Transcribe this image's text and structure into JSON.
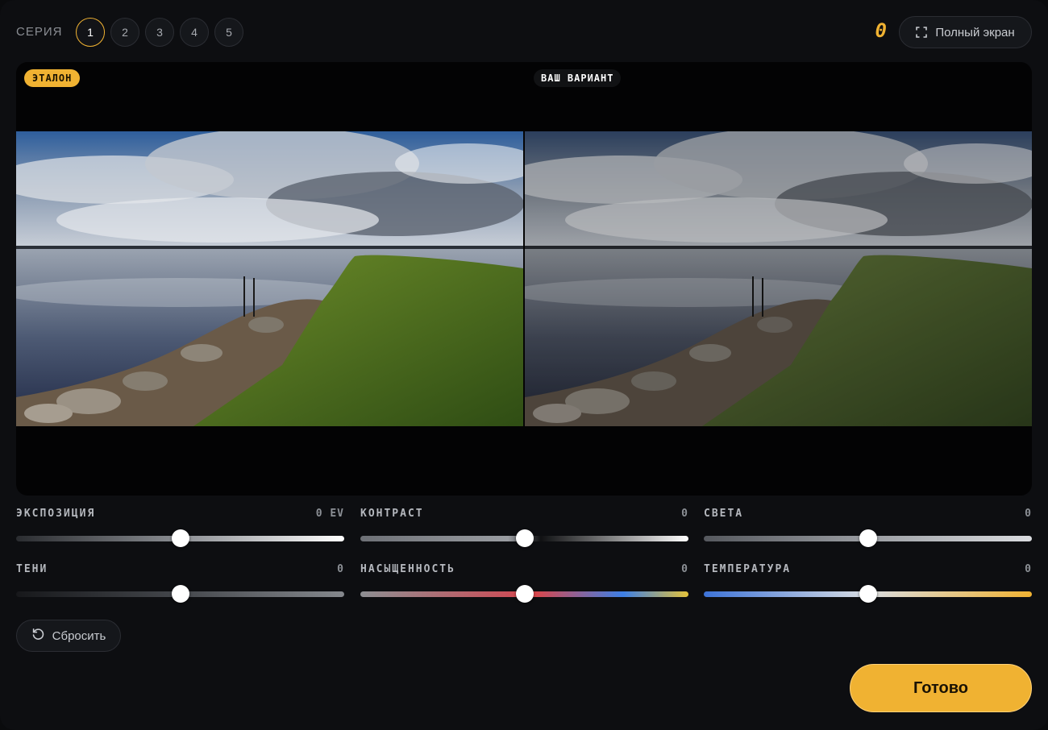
{
  "header": {
    "series_label": "СЕРИЯ",
    "series_tabs": [
      "1",
      "2",
      "3",
      "4",
      "5"
    ],
    "active_series": "1",
    "score": "0",
    "fullscreen_label": "Полный экран"
  },
  "viewer": {
    "reference_badge": "ЭТАЛОН",
    "yours_badge": "ВАШ ВАРИАНТ"
  },
  "controls": {
    "exposure": {
      "label": "ЭКСПОЗИЦИЯ",
      "value": "0 EV",
      "position": 0.5
    },
    "contrast": {
      "label": "КОНТРАСТ",
      "value": "0",
      "position": 0.5
    },
    "highlights": {
      "label": "СВЕТА",
      "value": "0",
      "position": 0.5
    },
    "shadows": {
      "label": "ТЕНИ",
      "value": "0",
      "position": 0.5
    },
    "saturation": {
      "label": "НАСЫЩЕННОСТЬ",
      "value": "0",
      "position": 0.5
    },
    "temperature": {
      "label": "ТЕМПЕРАТУРА",
      "value": "0",
      "position": 0.5
    }
  },
  "actions": {
    "reset_label": "Сбросить",
    "done_label": "Готово"
  },
  "colors": {
    "accent": "#f0b232",
    "background": "#0d0e11"
  }
}
